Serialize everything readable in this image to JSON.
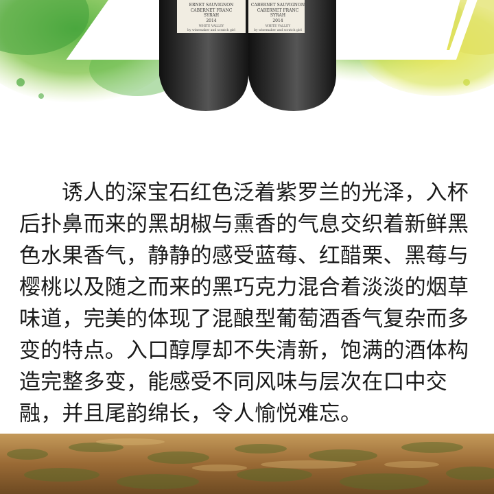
{
  "hero": {
    "bottle_left_label": {
      "line1": "ERNET SAUVIGNON",
      "line2": "CABERNET FRANC",
      "line3": "SYRAH",
      "year": "2014",
      "region": "WHITE VALLEY",
      "maker": "by winemaker and scratch girl"
    },
    "bottle_right_label": {
      "line1": "CABERNET SAUVIGNON",
      "line2": "CABERNET FRANC",
      "line3": "SYRAH",
      "year": "2014",
      "region": "WHITE VALLEY",
      "maker": "by winemaker and scratch girl"
    }
  },
  "description": {
    "lines": [
      "诱人的深宝石红色泛着紫罗兰的光泽，入杯",
      "后扑鼻而来的黑胡椒与熏香的气息交织着新鲜黑",
      "色水果香气，静静的感受蓝莓、红醋栗、黑莓与",
      "樱桃以及随之而来的黑巧克力混合着淡淡的烟草",
      "味道，完美的体现了混酿型葡萄酒香气复杂而多",
      "变的特点。入口醇厚却不失清新，饱满的酒体构",
      "造完整多变，能感受不同风味与层次在口中交",
      "融，并且尾韵绵长，令人愉悦难忘。"
    ]
  },
  "colors": {
    "watercolor_green": "#7cc142",
    "watercolor_lime": "#d6e24a",
    "bottle_dark": "#2a2a2a",
    "vineyard_brown": "#9a6a35"
  }
}
